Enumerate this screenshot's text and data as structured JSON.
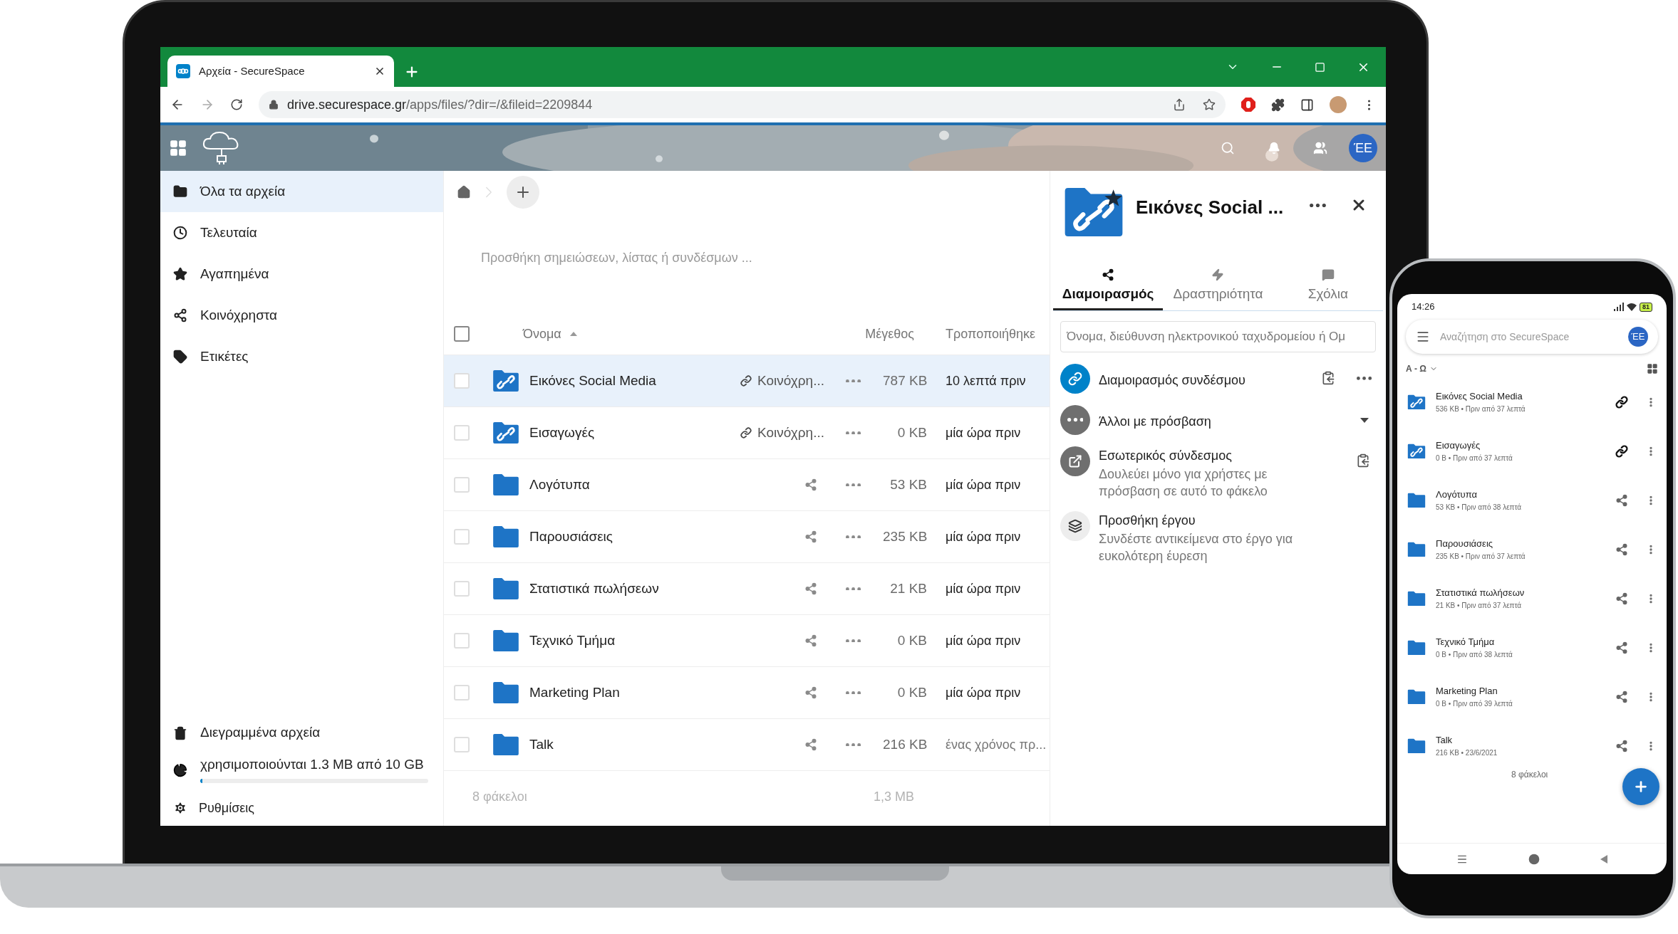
{
  "browser": {
    "tab_title": "Αρχεία - SecureSpace",
    "url_domain": "drive.securespace.gr",
    "url_path": "/apps/files/?dir=/&fileid=2209844"
  },
  "header": {
    "avatar": "ΈΕ"
  },
  "sidebar": {
    "items": [
      {
        "label": "Όλα τα αρχεία",
        "kind": "folder",
        "selected": true
      },
      {
        "label": "Τελευταία",
        "kind": "recent",
        "selected": false
      },
      {
        "label": "Αγαπημένα",
        "kind": "favorites",
        "selected": false
      },
      {
        "label": "Κοινόχρηστα",
        "kind": "shared",
        "selected": false
      },
      {
        "label": "Ετικέτες",
        "kind": "tags",
        "selected": false
      }
    ],
    "trash": "Διεγραμμένα αρχεία",
    "storage": {
      "text": "χρησιμοποιούνται 1.3 MB από 10 GB",
      "level": 0.01
    },
    "settings": "Ρυθμίσεις"
  },
  "notes_placeholder": "Προσθήκη σημειώσεων, λίστας ή συνδέσμων ...",
  "table": {
    "columns": [
      "Όνομα",
      "Μέγεθος",
      "Τροποποιήθηκε"
    ],
    "select_all_checked": false,
    "rows": [
      {
        "name": "Εικόνες Social Media",
        "kind": "link",
        "share": "Κοινόχρη...",
        "size": "787 KB",
        "modified": "10 λεπτά πριν",
        "recent": true,
        "selected": true
      },
      {
        "name": "Εισαγωγές",
        "kind": "link",
        "share": "Κοινόχρη...",
        "size": "0 KB",
        "modified": "μία ώρα πριν",
        "recent": true,
        "selected": false
      },
      {
        "name": "Λογότυπα",
        "kind": "folder",
        "size": "53 KB",
        "modified": "μία ώρα πριν",
        "recent": true,
        "selected": false
      },
      {
        "name": "Παρουσιάσεις",
        "kind": "folder",
        "size": "235 KB",
        "modified": "μία ώρα πριν",
        "recent": true,
        "selected": false
      },
      {
        "name": "Στατιστικά πωλήσεων",
        "kind": "folder",
        "size": "21 KB",
        "modified": "μία ώρα πριν",
        "recent": true,
        "selected": false
      },
      {
        "name": "Τεχνικό Τμήμα",
        "kind": "folder",
        "size": "0 KB",
        "modified": "μία ώρα πριν",
        "recent": true,
        "selected": false
      },
      {
        "name": "Marketing Plan",
        "kind": "folder",
        "size": "0 KB",
        "modified": "μία ώρα πριν",
        "recent": true,
        "selected": false
      },
      {
        "name": "Talk",
        "kind": "folder",
        "size": "216 KB",
        "modified": "ένας χρόνος πρ...",
        "recent": false,
        "selected": false
      }
    ],
    "summary": {
      "count": "8 φάκελοι",
      "size": "1,3 MB"
    }
  },
  "details": {
    "title": "Εικόνες Social ...",
    "favorite": true,
    "tabs": [
      {
        "label": "Διαμοιρασμός",
        "kind": "share",
        "selected": true
      },
      {
        "label": "Δραστηριότητα",
        "kind": "activity",
        "selected": false
      },
      {
        "label": "Σχόλια",
        "kind": "comments",
        "selected": false
      }
    ],
    "search_placeholder": "Όνομα, διεύθυνση ηλεκτρονικού ταχυδρομείου ή Ομ",
    "entries": [
      {
        "kind": "link",
        "title": "Διαμοιρασμός συνδέσμου"
      },
      {
        "kind": "others",
        "title": "Άλλοι με πρόσβαση"
      },
      {
        "kind": "internal",
        "title": "Εσωτερικός σύνδεσμος",
        "subtitle": "Δουλεύει μόνο για χρήστες με πρόσβαση σε αυτό το φάκελο"
      },
      {
        "kind": "project",
        "title": "Προσθήκη έργου",
        "subtitle": "Συνδέστε αντικείμενα στο έργο για ευκολότερη έυρεση"
      }
    ]
  },
  "phone": {
    "time": "14:26",
    "battery": "81",
    "search_placeholder": "Αναζήτηση στο SecureSpace",
    "avatar": "ΈΕ",
    "sort": "Α - Ω",
    "items": [
      {
        "name": "Εικόνες Social Media",
        "meta": "536 KB • Πριν από 37 λεπτά",
        "kind": "link"
      },
      {
        "name": "Εισαγωγές",
        "meta": "0 B • Πριν από 37 λεπτά",
        "kind": "link"
      },
      {
        "name": "Λογότυπα",
        "meta": "53 KB • Πριν από 38 λεπτά",
        "kind": "folder"
      },
      {
        "name": "Παρουσιάσεις",
        "meta": "235 KB • Πριν από 37 λεπτά",
        "kind": "folder"
      },
      {
        "name": "Στατιστικά πωλήσεων",
        "meta": "21 KB • Πριν από 37 λεπτά",
        "kind": "folder"
      },
      {
        "name": "Τεχνικό Τμήμα",
        "meta": "0 B • Πριν από 38 λεπτά",
        "kind": "folder"
      },
      {
        "name": "Marketing Plan",
        "meta": "0 B • Πριν από 39 λεπτά",
        "kind": "folder"
      },
      {
        "name": "Talk",
        "meta": "216 KB • 23/6/2021",
        "kind": "folder"
      }
    ],
    "count": "8 φάκελοι"
  }
}
